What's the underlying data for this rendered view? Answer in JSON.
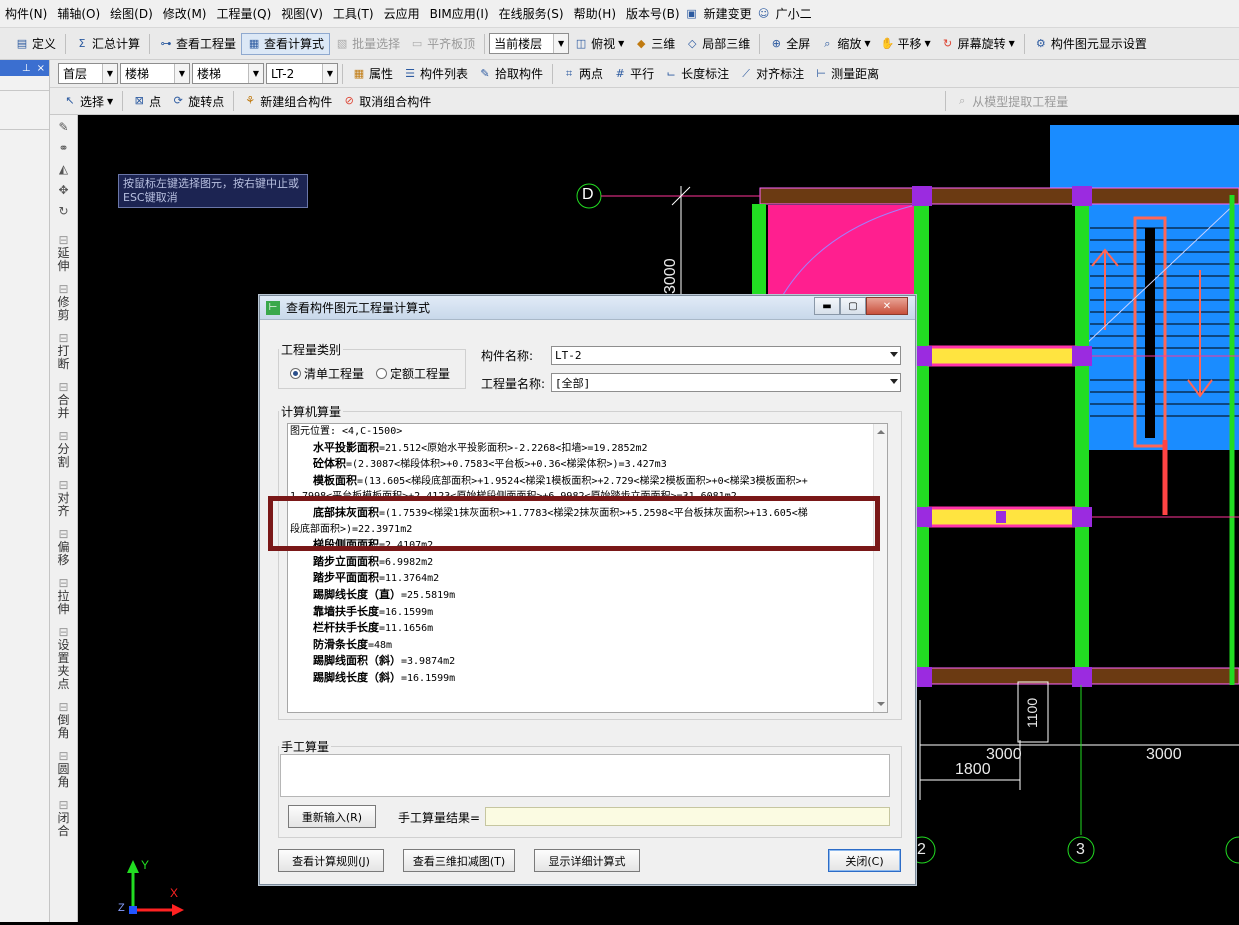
{
  "menu": [
    "构件(N)",
    "辅轴(O)",
    "绘图(D)",
    "修改(M)",
    "工程量(Q)",
    "视图(V)",
    "工具(T)",
    "云应用",
    "BIM应用(I)",
    "在线服务(S)",
    "帮助(H)",
    "版本号(B)",
    "新建变更",
    "广小二"
  ],
  "toolbar1": {
    "define": "定义",
    "summary": "汇总计算",
    "view_quantity": "查看工程量",
    "view_formula": "查看计算式",
    "batch_select": "批量选择",
    "flush_slab": "平齐板顶",
    "floor_scope": "当前楼层",
    "top_view": "俯视",
    "three_d": "三维",
    "local_3d": "局部三维",
    "fullscreen": "全屏",
    "zoom": "缩放",
    "pan": "平移",
    "rotate": "屏幕旋转",
    "display_settings": "构件图元显示设置"
  },
  "toolbar2": {
    "floor": "首层",
    "category": "楼梯",
    "type": "楼梯",
    "member": "LT-2",
    "properties": "属性",
    "member_list": "构件列表",
    "pick_member": "拾取构件",
    "two_points": "两点",
    "parallel": "平行",
    "length_dim": "长度标注",
    "aligned_dim": "对齐标注",
    "measure": "测量距离"
  },
  "toolbar3": {
    "select": "选择",
    "point": "点",
    "rotate_point": "旋转点",
    "new_group": "新建组合构件",
    "cancel_group": "取消组合构件",
    "extract_model": "从模型提取工程量"
  },
  "left_panel": {
    "pin": "ᅟ",
    "close": "×"
  },
  "vertical_tools": [
    "延伸",
    "修剪",
    "打断",
    "合并",
    "分割",
    "对齐",
    "偏移",
    "拉伸",
    "设置夹点",
    "倒角",
    "圆角",
    "闭合"
  ],
  "canvas": {
    "hint": "按鼠标左键选择图元，按右键中止或ESC键取消",
    "axis_d": "D",
    "dim_3000_v": "3000",
    "dim_1100": "1100",
    "dim_3000_a": "3000",
    "dim_3000_b": "3000",
    "dim_1800": "1800",
    "axis_2": "2",
    "axis_3": "3",
    "ucs_y": "Y",
    "ucs_x": "X",
    "ucs_z": "Z"
  },
  "dialog": {
    "title": "查看构件图元工程量计算式",
    "qty_type_label": "工程量类别",
    "radio_list": "清单工程量",
    "radio_quota": "定额工程量",
    "member_name_label": "构件名称:",
    "member_name_value": "LT-2",
    "qty_name_label": "工程量名称:",
    "qty_name_value": "[全部]",
    "computer_calc_label": "计算机算量",
    "lines": [
      {
        "name": "",
        "text": "图元位置: <4,C-1500>"
      },
      {
        "name": "水平投影面积",
        "text": "=21.512<原始水平投影面积>-2.2268<扣墙>=19.2852m2"
      },
      {
        "name": "砼体积",
        "text": "=(2.3087<梯段体积>+0.7583<平台板>+0.36<梯梁体积>)=3.427m3"
      },
      {
        "name": "模板面积",
        "text": "=(13.605<梯段底部面积>+1.9524<梯梁1模板面积>+2.729<梯梁2模板面积>+0<梯梁3模板面积>+"
      },
      {
        "name": "",
        "text": "1.7998<平台板模板面积>+2.4123<原始梯段侧面面积>+6.9982<原始踏步立面面积>=31.6081m2"
      },
      {
        "name": "底部抹灰面积",
        "text": "=(1.7539<梯梁1抹灰面积>+1.7783<梯梁2抹灰面积>+5.2598<平台板抹灰面积>+13.605<梯"
      },
      {
        "name": "",
        "text": "段底部面积>)=22.3971m2"
      },
      {
        "name": "梯段侧面面积",
        "text": "=2.4107m2"
      },
      {
        "name": "踏步立面面积",
        "text": "=6.9982m2"
      },
      {
        "name": "踏步平面面积",
        "text": "=11.3764m2"
      },
      {
        "name": "踢脚线长度（直）",
        "text": "=25.5819m"
      },
      {
        "name": "靠墙扶手长度",
        "text": "=16.1599m"
      },
      {
        "name": "栏杆扶手长度",
        "text": "=11.1656m"
      },
      {
        "name": "防滑条长度",
        "text": "=48m"
      },
      {
        "name": "踢脚线面积（斜）",
        "text": "=3.9874m2"
      },
      {
        "name": "踢脚线长度（斜）",
        "text": "=16.1599m"
      }
    ],
    "manual_label": "手工算量",
    "reinput": "重新输入(R)",
    "manual_result_label": "手工算量结果=",
    "manual_result_value": "",
    "view_rules": "查看计算规则(J)",
    "view_3d_deduct": "查看三维扣减图(T)",
    "show_detail": "显示详细计算式",
    "close": "关闭(C)"
  },
  "colors": {
    "green": "#22dd22",
    "magenta": "#ff33aa",
    "purple": "#9b2be0",
    "blue": "#1a8cff",
    "brown": "#6b3a12",
    "yellow": "#ffe440",
    "highlight_border": "#7a1818"
  }
}
